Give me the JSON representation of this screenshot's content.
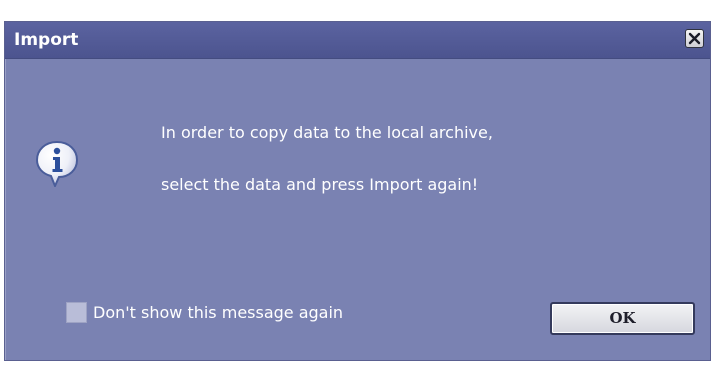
{
  "dialog": {
    "title": "Import",
    "close_icon": "close-icon",
    "info_icon": "info-icon",
    "message_line1": "In order to copy data to the local archive,",
    "message_line2": "select the data and press Import again!",
    "checkbox_label": "Don't show this message again",
    "checkbox_checked": false,
    "ok_label": "OK",
    "colors": {
      "background": "#7a82b2",
      "titlebar": "#4c548f",
      "text": "#ffffff"
    }
  }
}
